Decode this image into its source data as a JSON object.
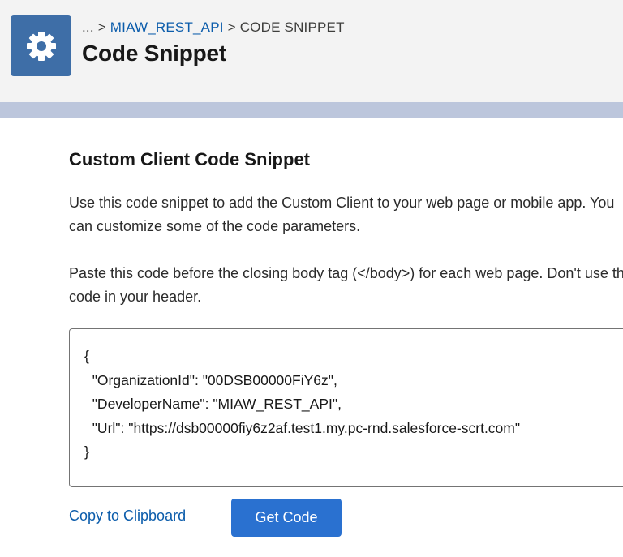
{
  "header": {
    "breadcrumb_ellipsis": "...",
    "breadcrumb_sep": ">",
    "breadcrumb_parent": "MIAW_REST_API",
    "breadcrumb_current": "CODE SNIPPET",
    "title": "Code Snippet",
    "icon": "gear-icon"
  },
  "main": {
    "section_title": "Custom Client Code Snippet",
    "intro": "Use this code snippet to add the Custom Client to your web page or mobile app. You can customize some of the code parameters.",
    "instructions": "Paste this code before the closing body tag (</body>) for each web page. Don't use the code in your header.",
    "code": "{\n  \"OrganizationId\": \"00DSB00000FiY6z\",\n  \"DeveloperName\": \"MIAW_REST_API\",\n  \"Url\": \"https://dsb00000fiy6z2af.test1.my.pc-rnd.salesforce-scrt.com\"\n}"
  },
  "actions": {
    "copy_label": "Copy to Clipboard",
    "get_code_label": "Get Code"
  },
  "colors": {
    "icon_bg": "#3e6ea7",
    "link": "#0b5cab",
    "button_bg": "#2a71d0",
    "header_band": "#bcc6dc"
  }
}
